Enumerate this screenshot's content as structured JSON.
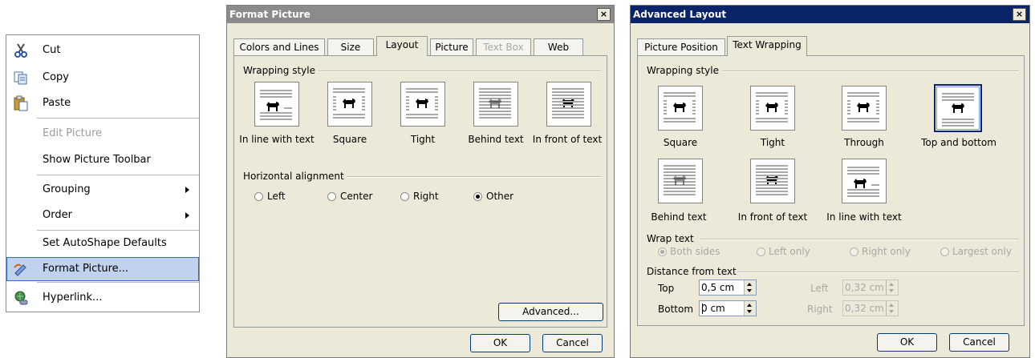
{
  "context_menu": {
    "items": [
      {
        "label": "Cut",
        "icon": "scissors-icon",
        "enabled": true
      },
      {
        "label": "Copy",
        "icon": "copy-icon",
        "enabled": true
      },
      {
        "label": "Paste",
        "icon": "paste-icon",
        "enabled": true
      },
      {
        "label": "Edit Picture",
        "enabled": false
      },
      {
        "label": "Show Picture Toolbar",
        "enabled": true
      },
      {
        "label": "Grouping",
        "enabled": true,
        "submenu": true
      },
      {
        "label": "Order",
        "enabled": true,
        "submenu": true
      },
      {
        "label": "Set AutoShape Defaults",
        "enabled": true
      },
      {
        "label": "Format Picture...",
        "icon": "format-picture-icon",
        "enabled": true,
        "highlighted": true
      },
      {
        "label": "Hyperlink...",
        "icon": "hyperlink-icon",
        "enabled": true
      }
    ]
  },
  "format_picture": {
    "title": "Format Picture",
    "close_label": "×",
    "tabs": [
      {
        "label": "Colors and Lines"
      },
      {
        "label": "Size"
      },
      {
        "label": "Layout",
        "active": true
      },
      {
        "label": "Picture"
      },
      {
        "label": "Text Box",
        "disabled": true
      },
      {
        "label": "Web"
      }
    ],
    "wrapping_style_label": "Wrapping style",
    "wrapping_options": [
      {
        "label": "In line with text"
      },
      {
        "label": "Square"
      },
      {
        "label": "Tight"
      },
      {
        "label": "Behind text"
      },
      {
        "label": "In front of text"
      }
    ],
    "horizontal_alignment_label": "Horizontal alignment",
    "alignment_options": [
      {
        "label": "Left",
        "selected": false
      },
      {
        "label": "Center",
        "selected": false
      },
      {
        "label": "Right",
        "selected": false
      },
      {
        "label": "Other",
        "selected": true
      }
    ],
    "advanced_button": "Advanced...",
    "ok_button": "OK",
    "cancel_button": "Cancel"
  },
  "advanced_layout": {
    "title": "Advanced Layout",
    "close_label": "×",
    "tabs": [
      {
        "label": "Picture Position"
      },
      {
        "label": "Text Wrapping",
        "active": true
      }
    ],
    "wrapping_style_label": "Wrapping style",
    "wrapping_options": [
      {
        "label": "Square"
      },
      {
        "label": "Tight"
      },
      {
        "label": "Through"
      },
      {
        "label": "Top and bottom",
        "selected": true
      },
      {
        "label": "Behind text"
      },
      {
        "label": "In front of text"
      },
      {
        "label": "In line with text"
      }
    ],
    "wrap_text_label": "Wrap text",
    "wrap_text_options": [
      {
        "label": "Both sides",
        "selected": true
      },
      {
        "label": "Left only"
      },
      {
        "label": "Right only"
      },
      {
        "label": "Largest only"
      }
    ],
    "distance_label": "Distance from text",
    "top_label": "Top",
    "top_value": "0,5 cm",
    "bottom_label": "Bottom",
    "bottom_value": "0 cm",
    "left_label": "Left",
    "left_value": "0,32 cm",
    "right_label": "Right",
    "right_value": "0,32 cm",
    "ok_button": "OK",
    "cancel_button": "Cancel"
  },
  "colors": {
    "titlebar_active": "#0a246a",
    "titlebar_inactive": "#8b8b8b",
    "dialog_bg": "#ece9d8",
    "menu_highlight": "#c1d2ee"
  }
}
